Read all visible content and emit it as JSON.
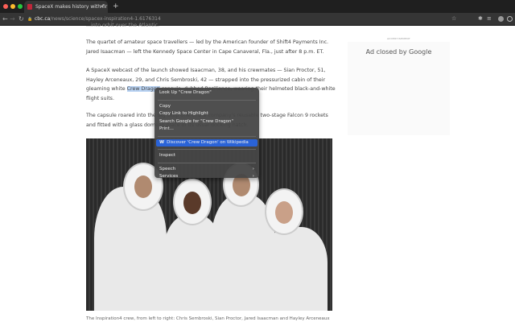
{
  "browser": {
    "tab_title": "SpaceX makes history with fir",
    "url_domain": "cbc.ca",
    "url_path": "/news/science/spacex-inspiration4-1.6176314",
    "new_tab": "+",
    "close": "✕"
  },
  "article": {
    "top_line": "...into orbit over the Atlantic.",
    "p1": "The quartet of amateur space travellers — led by the American founder of Shift4 Payments Inc. Jared Isaacman — left the Kennedy Space Center in Cape Canaveral, Fla., just after 8 p.m. ET.",
    "p2_before": "A SpaceX webcast of the launch showed Isaacman, 38, and his crewmates — Sian Proctor, 51, Hayley Arceneaux, 29, and Chris Sembroski, 42 — strapped into the pressurized cabin of their gleaming white ",
    "p2_selected": "Crew Dragon",
    "p2_after": " capsule, dubbed Resilience, wearing their helmeted black-and-white flight suits.",
    "p3": "The capsule roared into the sky atop one of the company's reusable two-stage Falcon 9 rockets and fitted with a glass dome in place of its usual docking hatch.",
    "caption": "The Inspiration4 crew, from left to right: Chris Sembroski, Sian Proctor, Jared Isaacman and Hayley Arceneaux"
  },
  "ad": {
    "label": "ADVERTISEMENT",
    "text": "Ad closed by Google"
  },
  "context_menu": {
    "items": [
      {
        "label": "Look Up \"Crew Dragon\""
      },
      {
        "label": "Copy"
      },
      {
        "label": "Copy Link to Highlight"
      },
      {
        "label": "Search Google for \"Crew Dragon\""
      },
      {
        "label": "Print..."
      },
      {
        "label": "Discover 'Crew Dragon' on Wikipedia"
      },
      {
        "label": "Inspect"
      },
      {
        "label": "Speech"
      },
      {
        "label": "Services"
      }
    ],
    "wiki_icon": "W",
    "submenu_arrow": "›"
  },
  "colors": {
    "selection": "#2a63d8",
    "tabbar": "#1f1f1f",
    "toolbar": "#353535"
  }
}
